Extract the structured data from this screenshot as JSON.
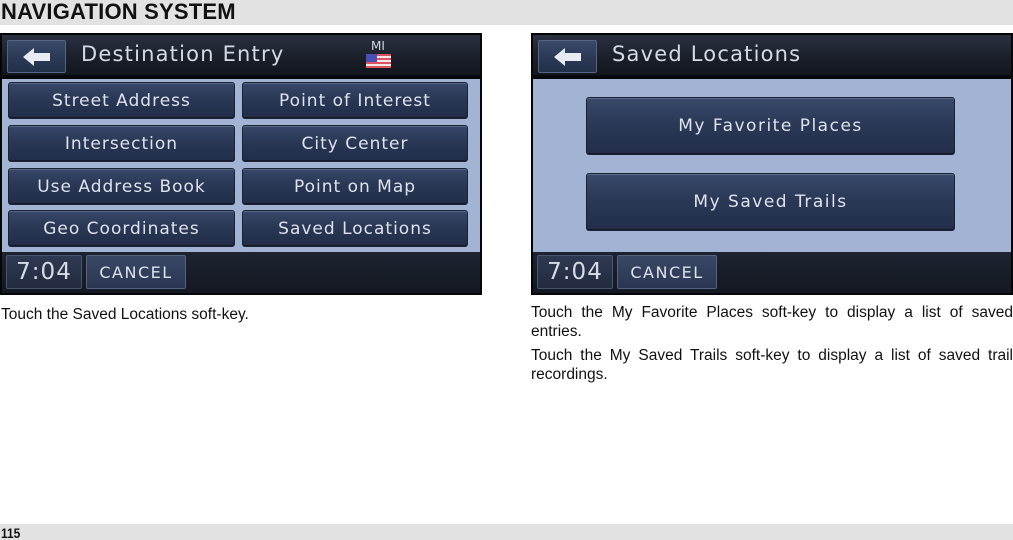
{
  "page": {
    "section_title": "NAVIGATION SYSTEM",
    "page_number": "115"
  },
  "left_screen": {
    "title": "Destination Entry",
    "region": "MI",
    "buttons": [
      {
        "label": "Street Address"
      },
      {
        "label": "Point of Interest"
      },
      {
        "label": "Intersection"
      },
      {
        "label": "City Center"
      },
      {
        "label": "Use Address Book"
      },
      {
        "label": "Point on Map"
      },
      {
        "label": "Geo Coordinates"
      },
      {
        "label": "Saved Locations"
      }
    ],
    "clock": "7:04",
    "cancel_label": "CANCEL",
    "caption": "Touch the Saved Locations soft-key."
  },
  "right_screen": {
    "title": "Saved Locations",
    "buttons": [
      {
        "label": "My Favorite Places"
      },
      {
        "label": "My Saved Trails"
      }
    ],
    "clock": "7:04",
    "cancel_label": "CANCEL",
    "captions": [
      "Touch the My Favorite Places soft-key to display a list of saved entries.",
      "Touch the My Saved Trails soft-key to display a list of saved trail recordings."
    ]
  },
  "colors": {
    "page_bar": "#e2e2e2",
    "screen_content_bg": "#a3b3d4",
    "button_bg": "#2a3856",
    "button_text": "#dde3ee"
  }
}
